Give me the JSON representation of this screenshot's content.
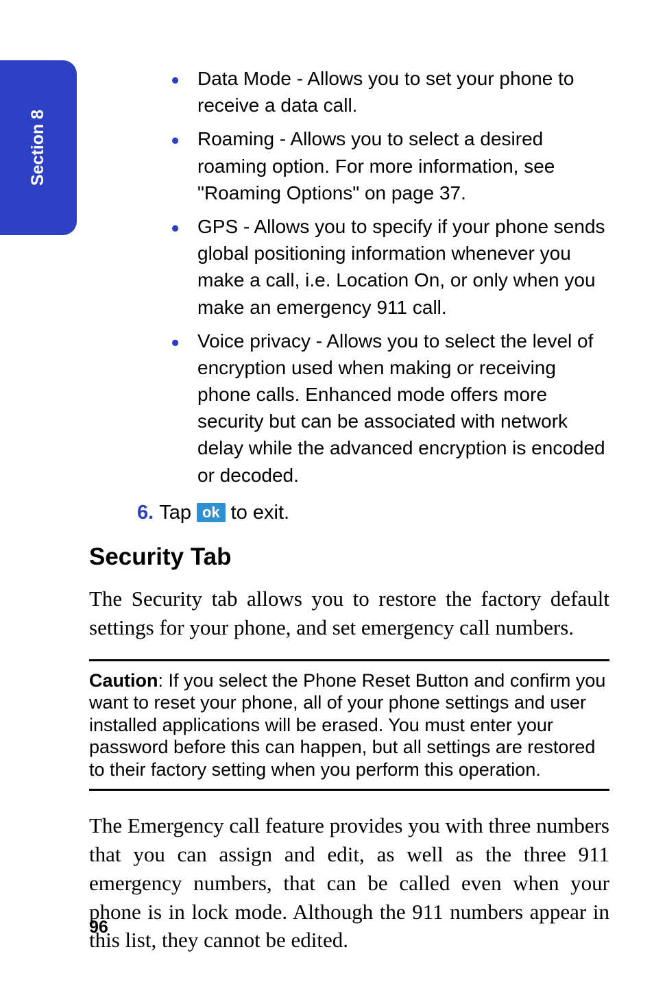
{
  "sectionTab": "Section 8",
  "bullets": [
    "Data Mode - Allows you to set your phone to receive a data call.",
    "Roaming - Allows you to select a desired roaming option. For more information, see \"Roaming Options\" on page 37.",
    "GPS - Allows you to specify if your phone sends global positioning information whenever you make a call, i.e. Location On, or only when you make an emergency 911 call.",
    "Voice privacy - Allows you to select the level of encryption used when making or receiving phone calls. Enhanced mode offers more security but can be associated with network delay while the advanced encryption is encoded or decoded."
  ],
  "step": {
    "number": "6.",
    "textBefore": "Tap",
    "okLabel": "ok",
    "textAfter": "to exit."
  },
  "heading": "Security Tab",
  "paragraph1": "The Security tab allows you to restore the factory default settings for your phone, and set emergency call numbers.",
  "caution": {
    "label": "Caution",
    "text": ": If you select the Phone Reset Button and confirm you want to reset your phone, all of your phone settings and user installed applications will be erased. You must enter your password before this can happen, but all settings are restored to their factory setting when you perform this operation."
  },
  "paragraph2": "The Emergency call feature provides you with three numbers that you can assign and edit, as well as the three 911 emergency numbers, that can be called even when your phone is in lock mode. Although the 911 numbers appear in this list, they cannot be edited.",
  "pageNumber": "96"
}
